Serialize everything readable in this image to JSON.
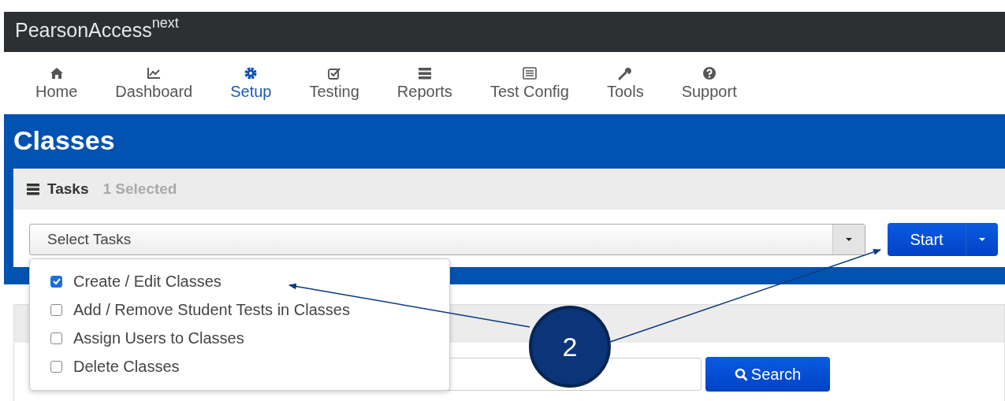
{
  "header": {
    "brand": "PearsonAccess",
    "brand_sup": "next"
  },
  "nav": [
    {
      "label": "Home",
      "kind": "home",
      "selected": false
    },
    {
      "label": "Dashboard",
      "kind": "chart",
      "selected": false
    },
    {
      "label": "Setup",
      "kind": "gear",
      "selected": true
    },
    {
      "label": "Testing",
      "kind": "check",
      "selected": false
    },
    {
      "label": "Reports",
      "kind": "list",
      "selected": false
    },
    {
      "label": "Test Config",
      "kind": "card",
      "selected": false
    },
    {
      "label": "Tools",
      "kind": "wrench",
      "selected": false
    },
    {
      "label": "Support",
      "kind": "help",
      "selected": false
    }
  ],
  "page_title": "Classes",
  "tasks": {
    "title": "Tasks",
    "count": "1 Selected",
    "select_placeholder": "Select Tasks",
    "start_button": "Start",
    "options": [
      {
        "label": "Create / Edit Classes",
        "checked": true
      },
      {
        "label": "Add / Remove Student Tests in Classes",
        "checked": false
      },
      {
        "label": "Assign Users to Classes",
        "checked": false
      },
      {
        "label": "Delete Classes",
        "checked": false
      }
    ]
  },
  "search_button": "Search",
  "callout": {
    "number": "2"
  }
}
